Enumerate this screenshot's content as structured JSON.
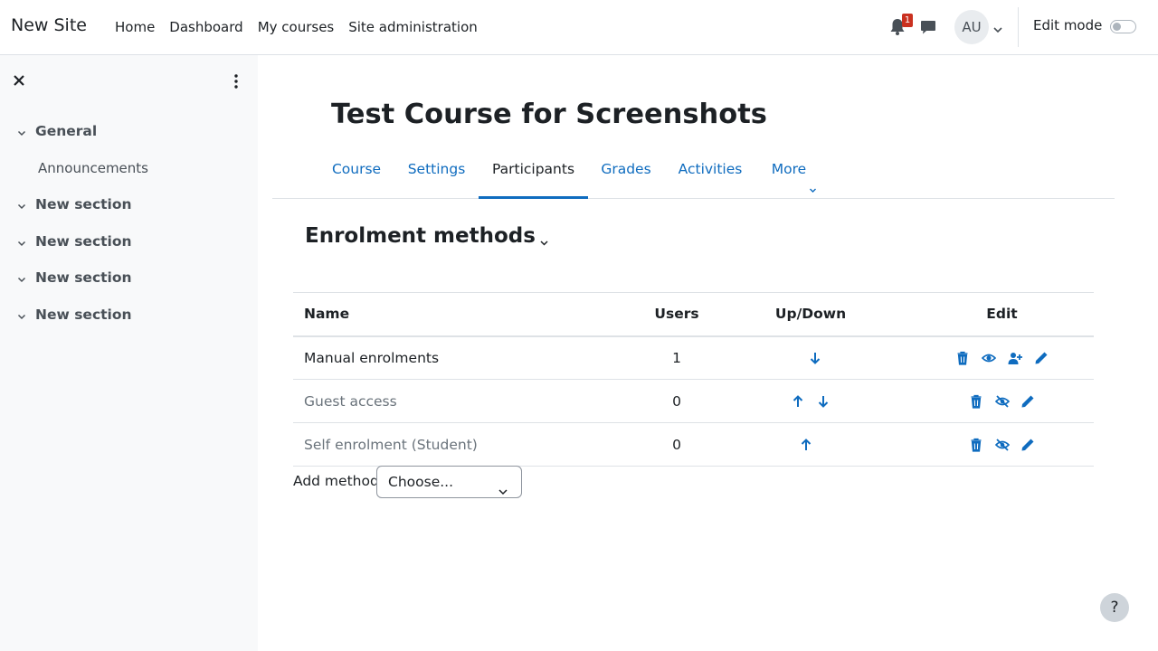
{
  "navbar": {
    "brand": "New Site",
    "links": [
      "Home",
      "Dashboard",
      "My courses",
      "Site administration"
    ],
    "notification_count": "1",
    "user_initials": "AU",
    "edit_mode_label": "Edit mode"
  },
  "drawer": {
    "sections": [
      "General",
      "New section",
      "New section",
      "New section",
      "New section"
    ],
    "activities": [
      "Announcements"
    ]
  },
  "course": {
    "title": "Test Course for Screenshots",
    "tabs": [
      "Course",
      "Settings",
      "Participants",
      "Grades",
      "Activities",
      "More"
    ],
    "active_tab": "Participants"
  },
  "page": {
    "heading": "Enrolment methods"
  },
  "table": {
    "headers": [
      "Name",
      "Users",
      "Up/Down",
      "Edit"
    ],
    "rows": [
      {
        "name": "Manual enrolments",
        "users": "1",
        "updown": [
          "down"
        ],
        "edit": [
          "delete",
          "hide",
          "enrol-users",
          "edit"
        ]
      },
      {
        "name": "Guest access",
        "users": "0",
        "updown": [
          "up",
          "down"
        ],
        "edit": [
          "delete",
          "show",
          "edit"
        ]
      },
      {
        "name": "Self enrolment (Student)",
        "users": "0",
        "updown": [
          "up"
        ],
        "edit": [
          "delete",
          "show",
          "edit"
        ]
      }
    ]
  },
  "add_method": {
    "label": "Add method",
    "selected": "Choose..."
  },
  "help": "?",
  "colors": {
    "link": "#0f6cbf",
    "text": "#1d2125",
    "drawer_bg": "#f8f9fa",
    "badge": "#ca3120"
  }
}
